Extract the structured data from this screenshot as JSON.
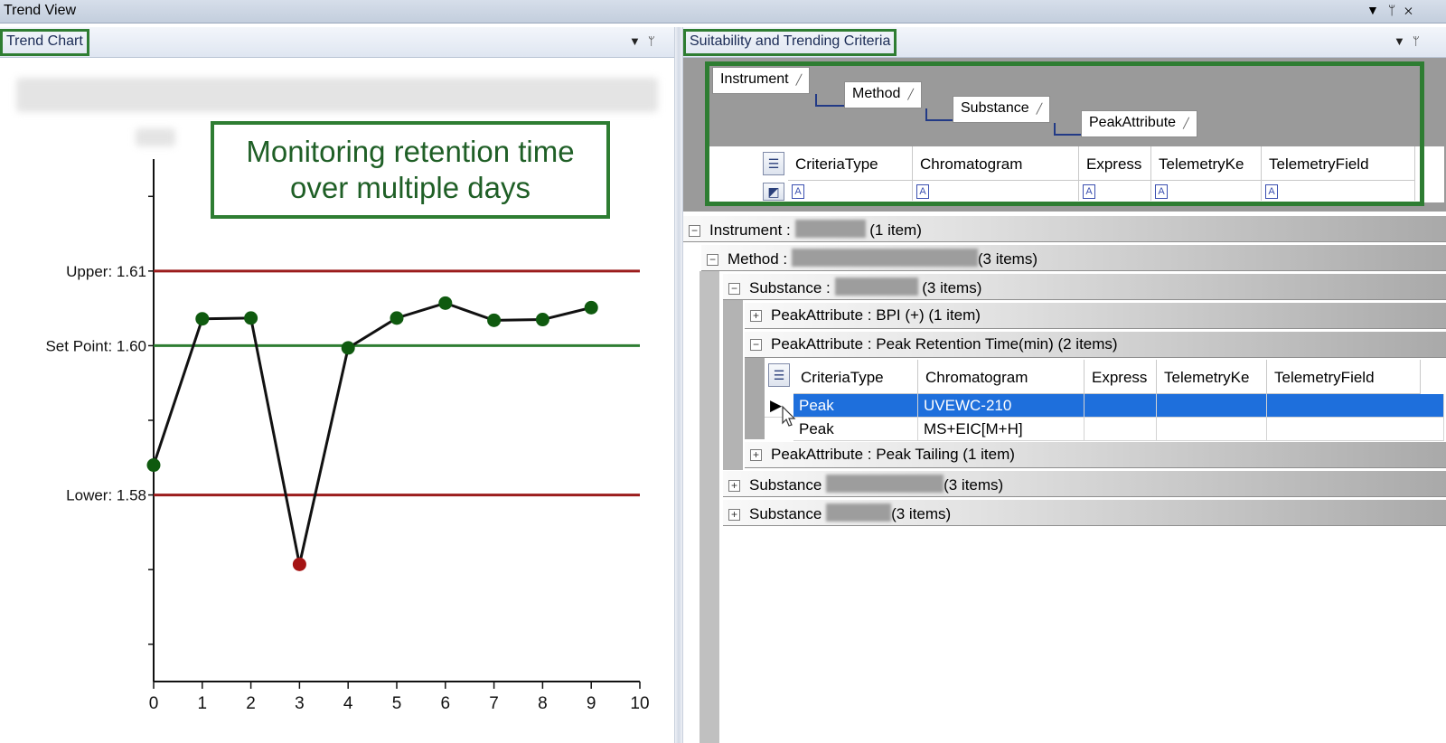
{
  "window": {
    "title": "Trend View",
    "icons": [
      "dropdown-icon",
      "pin-icon",
      "close-icon"
    ]
  },
  "left_panel": {
    "tab_label": "Trend Chart",
    "annotation_line1": "Monitoring retention time",
    "annotation_line2": "over multiple days"
  },
  "right_panel": {
    "tab_label": "Suitability and Trending Criteria",
    "group_by": [
      {
        "label": "Instrument"
      },
      {
        "label": "Method"
      },
      {
        "label": "Substance"
      },
      {
        "label": "PeakAttribute"
      }
    ],
    "columns": [
      "CriteriaType",
      "Chromatogram",
      "Express",
      "TelemetryKe",
      "TelemetryField"
    ],
    "filter_icon_glyph": "A",
    "groups": {
      "instrument": {
        "label": "Instrument :",
        "count": "(1 item)"
      },
      "method": {
        "label": "Method :",
        "count": "(3 items)"
      },
      "substance1": {
        "label": "Substance :",
        "count": "(3 items)"
      },
      "pa_bpi": {
        "label": "PeakAttribute : BPI (+) (1 item)"
      },
      "pa_rt": {
        "label": "PeakAttribute : Peak Retention Time(min) (2 items)"
      },
      "pa_tailing": {
        "label": "PeakAttribute : Peak Tailing (1 item)"
      },
      "substance2": {
        "label": "Substance",
        "count": "(3 items)"
      },
      "substance3": {
        "label": "Substance",
        "count": "(3 items)"
      }
    },
    "detail_rows": [
      {
        "criteria_type": "Peak",
        "chromatogram": "UVEWC-210",
        "selected": true
      },
      {
        "criteria_type": "Peak",
        "chromatogram": "MS+EIC[M+H]",
        "selected": false
      }
    ]
  },
  "chart_data": {
    "type": "line",
    "title": "",
    "xlabel": "",
    "ylabel": "",
    "x": [
      0,
      1,
      2,
      3,
      4,
      5,
      6,
      7,
      8,
      9
    ],
    "series": [
      {
        "values": [
          1.584,
          1.6036,
          1.6037,
          1.5707,
          1.5997,
          1.6037,
          1.6057,
          1.6034,
          1.6035,
          1.6051
        ]
      }
    ],
    "point_colors": [
      "#0f5a0f",
      "#0f5a0f",
      "#0f5a0f",
      "#a51414",
      "#0f5a0f",
      "#0f5a0f",
      "#0f5a0f",
      "#0f5a0f",
      "#0f5a0f",
      "#0f5a0f"
    ],
    "xlim": [
      0,
      10
    ],
    "ylim": [
      1.555,
      1.625
    ],
    "xticks": [
      "0",
      "1",
      "2",
      "3",
      "4",
      "5",
      "6",
      "7",
      "8",
      "9",
      "10"
    ],
    "reference_lines": [
      {
        "label": "Upper: 1.61",
        "value": 1.61,
        "color": "#9b1c1c"
      },
      {
        "label": "Set Point: 1.60",
        "value": 1.6,
        "color": "#2e7d32"
      },
      {
        "label": "Lower: 1.58",
        "value": 1.58,
        "color": "#9b1c1c"
      }
    ],
    "grid": false
  }
}
